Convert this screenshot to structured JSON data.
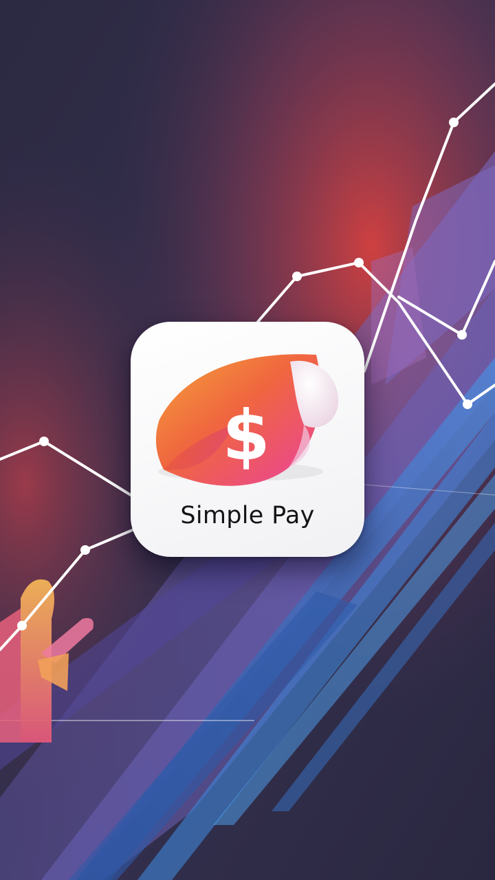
{
  "app": {
    "name": "Simple Pay",
    "logo_symbol": "$",
    "logo_icon": "dollar-leaf-icon"
  },
  "colors": {
    "background": "#2d2a44",
    "accent_red": "#d8474a",
    "accent_orange": "#f39a3d",
    "accent_pink": "#e9559d",
    "accent_blue": "#3f86d8",
    "accent_purple": "#6b5fb0",
    "icon_tile": "#ffffff",
    "label_text": "#141418"
  }
}
